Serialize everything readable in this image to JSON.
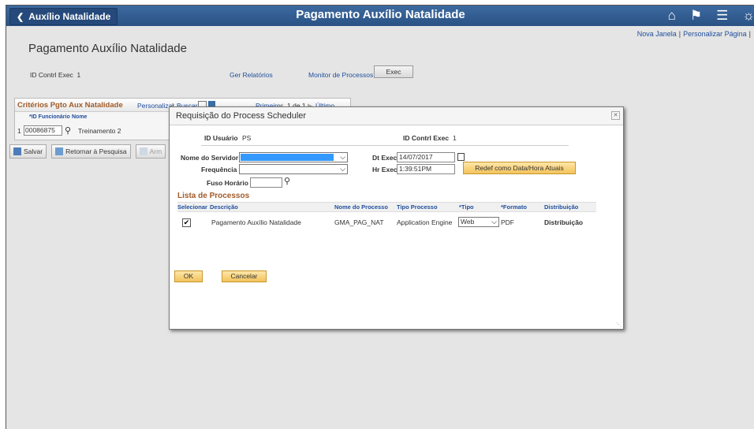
{
  "header": {
    "back_label": "Auxílio Natalidade",
    "title": "Pagamento Auxílio Natalidade",
    "icons": [
      "home-icon",
      "flag-icon",
      "menu-icon",
      "compass-icon"
    ]
  },
  "top_links": {
    "new_window": "Nova Janela",
    "personalize_page": "Personalizar Página"
  },
  "page": {
    "title": "Pagamento Auxílio Natalidade",
    "run_control_label": "ID Contrl Exec",
    "run_control_value": "1",
    "reports_link": "Ger Relatórios",
    "process_monitor_link": "Monitor de Processos",
    "exec_button": "Exec"
  },
  "grid": {
    "title": "Critérios Pgto Aux Natalidade",
    "personalize": "Personalizar",
    "search": "Buscar",
    "first": "Primeiro",
    "range": "1 de 1",
    "last": "Último",
    "col_id": "*ID Funcionário",
    "col_name": "Nome",
    "row_num": "1",
    "row_id": "00086875",
    "row_name": "Treinamento 2"
  },
  "toolbar": {
    "save": "Salvar",
    "return": "Retornar à Pesquisa",
    "notify": "Arm"
  },
  "dialog": {
    "title": "Requisição do Process Scheduler",
    "user_id_label": "ID Usuário",
    "user_id_value": "PS",
    "run_control_label": "ID Contrl Exec",
    "run_control_value": "1",
    "server_label": "Nome do Servidor",
    "frequency_label": "Frequência",
    "timezone_label": "Fuso Horário",
    "date_label": "Dt Exec",
    "date_value": "14/07/2017",
    "time_label": "Hr Exec",
    "time_value": "1:39:51PM",
    "reset_button": "Redef como Data/Hora Atuais",
    "process_list_title": "Lista de Processos",
    "columns": [
      "Selecionar",
      "Descrição",
      "Nome do Processo",
      "Tipo Processo",
      "*Tipo",
      "*Formato",
      "Distribuição"
    ],
    "row": {
      "selected": "✔",
      "description": "Pagamento Auxílio Natalidade",
      "process_name": "GMA_PAG_NAT",
      "process_type": "Application Engine",
      "type": "Web",
      "format": "PDF",
      "distribution": "Distribuição"
    },
    "ok_button": "OK",
    "cancel_button": "Cancelar"
  }
}
